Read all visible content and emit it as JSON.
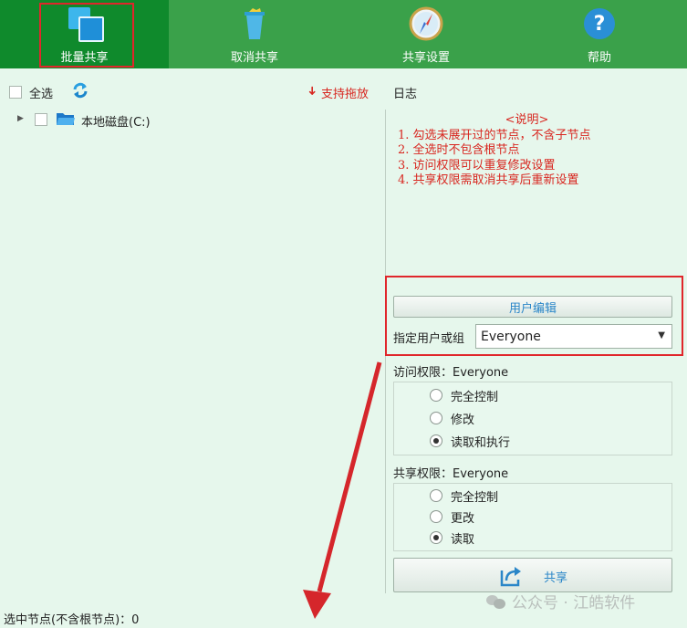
{
  "toolbar": {
    "items": [
      {
        "label": "批量共享",
        "icon": "batch-share-icon"
      },
      {
        "label": "取消共享",
        "icon": "trash-icon"
      },
      {
        "label": "共享设置",
        "icon": "compass-icon"
      },
      {
        "label": "帮助",
        "icon": "help-icon"
      }
    ],
    "help_glyph": "?"
  },
  "tree": {
    "select_all_label": "全选",
    "drag_hint": "支持拖放",
    "drag_arrow": "➜",
    "root_label": "本地磁盘(C:)"
  },
  "log": {
    "title": "日志",
    "notes_title": "<说明>",
    "notes": [
      "1. 勾选未展开过的节点，不含子节点",
      "2. 全选时不包含根节点",
      "3. 访问权限可以重复修改设置",
      "4. 共享权限需取消共享后重新设置"
    ]
  },
  "user": {
    "edit_button": "用户编辑",
    "select_label": "指定用户或组",
    "selected": "Everyone"
  },
  "access": {
    "title": "访问权限：Everyone",
    "options": [
      "完全控制",
      "修改",
      "读取和执行"
    ],
    "selected_index": 2
  },
  "share": {
    "title": "共享权限：Everyone",
    "options": [
      "完全控制",
      "更改",
      "读取"
    ],
    "selected_index": 2,
    "button_label": "共享"
  },
  "status": {
    "text": "选中节点(不含根节点)：0"
  },
  "watermark": "公众号 · 江皓软件",
  "colors": {
    "toolbar": "#3aa14a",
    "toolbar_active": "#0f8a2c",
    "background": "#e6f7ec",
    "accent_red": "#d8261f",
    "highlight": "#e0262b"
  }
}
